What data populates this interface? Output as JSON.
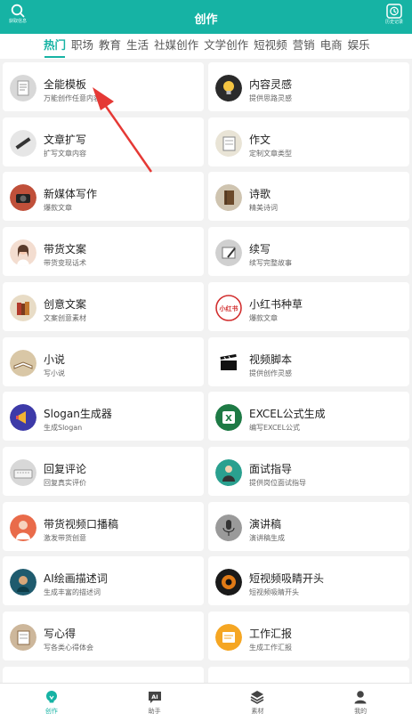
{
  "header": {
    "title": "创作",
    "left_label": "获取信息",
    "right_label": "历史记录"
  },
  "tabs": [
    {
      "label": "热门",
      "active": true
    },
    {
      "label": "职场"
    },
    {
      "label": "教育"
    },
    {
      "label": "生活"
    },
    {
      "label": "社媒创作"
    },
    {
      "label": "文学创作"
    },
    {
      "label": "短视频"
    },
    {
      "label": "营销"
    },
    {
      "label": "电商"
    },
    {
      "label": "娱乐"
    }
  ],
  "cards": [
    {
      "name": "全能模板",
      "desc": "万能创作任意内容",
      "icon": "paper-note-icon"
    },
    {
      "name": "内容灵感",
      "desc": "提供思路灵感",
      "icon": "lightbulb-icon"
    },
    {
      "name": "文章扩写",
      "desc": "扩写文章内容",
      "icon": "pencil-icon"
    },
    {
      "name": "作文",
      "desc": "定制文章类型",
      "icon": "notebook-icon"
    },
    {
      "name": "新媒体写作",
      "desc": "爆款文章",
      "icon": "camera-icon"
    },
    {
      "name": "诗歌",
      "desc": "精美诗词",
      "icon": "book-icon"
    },
    {
      "name": "带货文案",
      "desc": "带货变现话术",
      "icon": "woman-avatar-icon"
    },
    {
      "name": "续写",
      "desc": "续写完整故事",
      "icon": "writing-hand-icon"
    },
    {
      "name": "创意文案",
      "desc": "文案创意素材",
      "icon": "books-icon"
    },
    {
      "name": "小红书种草",
      "desc": "爆款文章",
      "icon": "xiaohongshu-stamp-icon",
      "icon_text": "小红书"
    },
    {
      "name": "小说",
      "desc": "写小说",
      "icon": "open-book-icon"
    },
    {
      "name": "视频脚本",
      "desc": "提供创作灵感",
      "icon": "clapperboard-icon"
    },
    {
      "name": "Slogan生成器",
      "desc": "生成Slogan",
      "icon": "megaphone-icon"
    },
    {
      "name": "EXCEL公式生成",
      "desc": "编写EXCEL公式",
      "icon": "excel-icon"
    },
    {
      "name": "回复评论",
      "desc": "回复真实评价",
      "icon": "keyboard-icon"
    },
    {
      "name": "面试指导",
      "desc": "提供岗位面试指导",
      "icon": "interview-person-icon"
    },
    {
      "name": "带货视频口播稿",
      "desc": "激发带货创意",
      "icon": "livestream-icon"
    },
    {
      "name": "演讲稿",
      "desc": "演讲稿生成",
      "icon": "microphone-icon"
    },
    {
      "name": "AI绘画描述词",
      "desc": "生成丰富的描述词",
      "icon": "painting-icon"
    },
    {
      "name": "短视频吸睛开头",
      "desc": "短视频吸睛开头",
      "icon": "eye-icon"
    },
    {
      "name": "写心得",
      "desc": "写各类心得体会",
      "icon": "journal-icon"
    },
    {
      "name": "工作汇报",
      "desc": "生成工作汇报",
      "icon": "report-board-icon"
    }
  ],
  "bottom_nav": [
    {
      "label": "创作",
      "icon": "bulb-create-icon",
      "active": true
    },
    {
      "label": "助手",
      "icon": "ai-chat-icon",
      "icon_text": "AI"
    },
    {
      "label": "素材",
      "icon": "layers-icon"
    },
    {
      "label": "我的",
      "icon": "person-icon"
    }
  ],
  "colors": {
    "accent": "#16b3a4",
    "annotation_arrow": "#e53935"
  }
}
